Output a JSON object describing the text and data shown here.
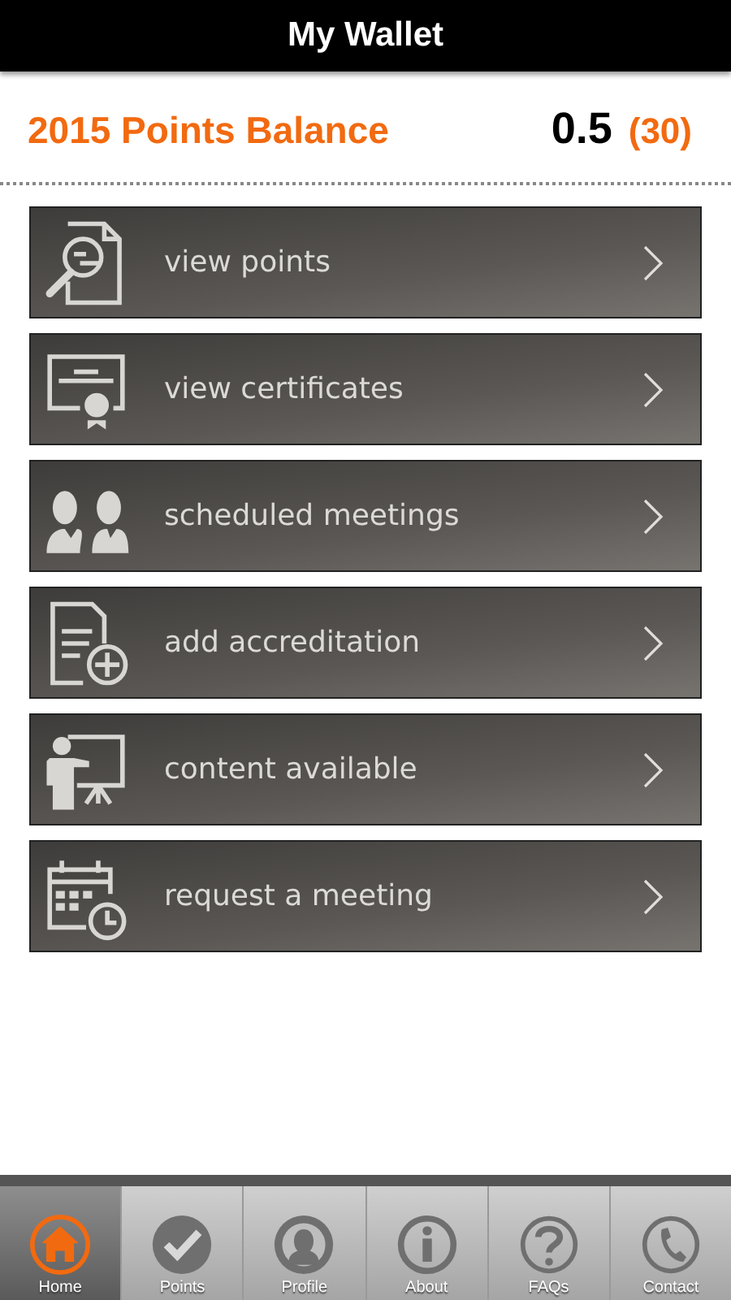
{
  "header": {
    "title": "My Wallet"
  },
  "balance": {
    "label": "2015 Points Balance",
    "value": "0.5",
    "target": "(30)"
  },
  "menu": [
    {
      "label": "view points",
      "kind": "points"
    },
    {
      "label": "view certificates",
      "kind": "certificate"
    },
    {
      "label": "scheduled meetings",
      "kind": "people"
    },
    {
      "label": "add accreditation",
      "kind": "add-document"
    },
    {
      "label": "content available",
      "kind": "presenter"
    },
    {
      "label": "request a meeting",
      "kind": "calendar"
    }
  ],
  "tab_bar": [
    {
      "label": "Home",
      "kind": "home",
      "selected": true
    },
    {
      "label": "Points",
      "kind": "check",
      "selected": false
    },
    {
      "label": "Profile",
      "kind": "person",
      "selected": false
    },
    {
      "label": "About",
      "kind": "info",
      "selected": false
    },
    {
      "label": "FAQs",
      "kind": "question",
      "selected": false
    },
    {
      "label": "Contact",
      "kind": "phone",
      "selected": false
    }
  ]
}
